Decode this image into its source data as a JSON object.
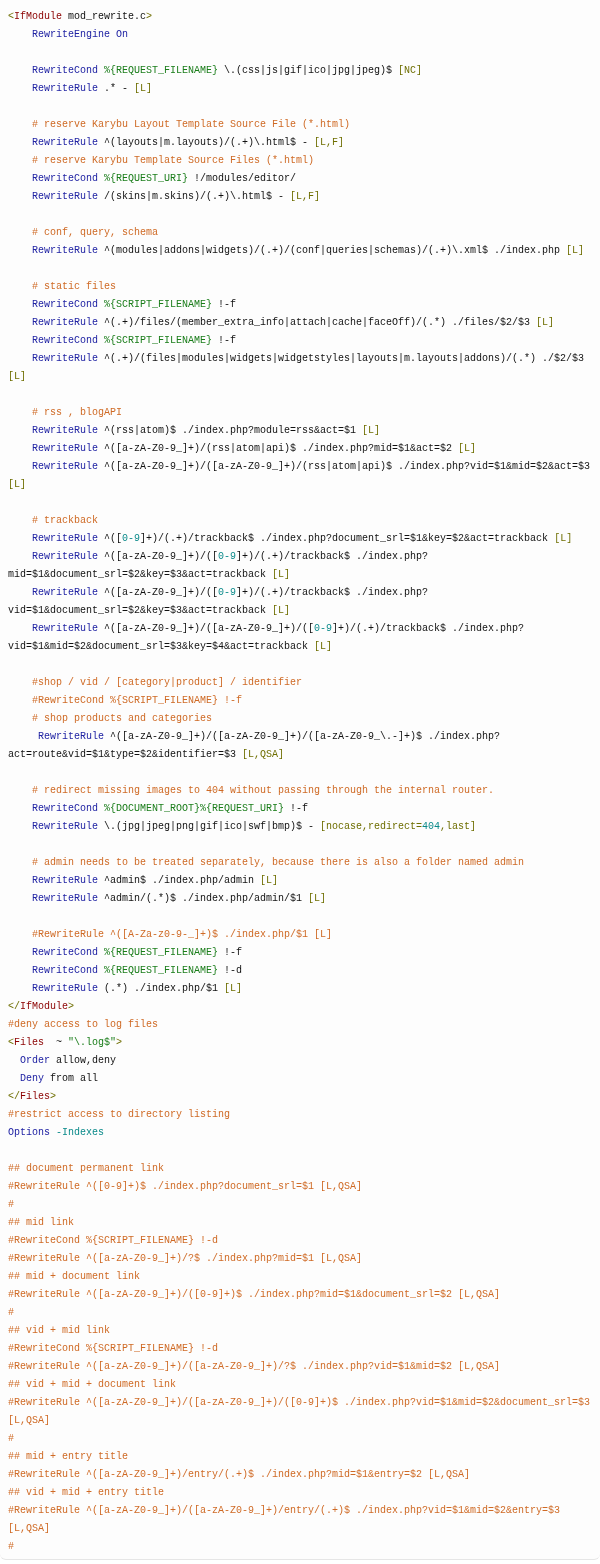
{
  "code_listing": {
    "lines": [
      {
        "kind": "plain",
        "tokens": [
          {
            "kind": "op",
            "text": "<"
          },
          {
            "kind": "tag",
            "text": "IfModule"
          },
          {
            "kind": "txt",
            "text": " mod_rewrite.c"
          },
          {
            "kind": "op",
            "text": ">"
          }
        ]
      },
      {
        "kind": "block",
        "tokens": [
          {
            "kind": "dir",
            "text": "RewriteEngine"
          },
          {
            "kind": "dir",
            "text": " On"
          }
        ]
      },
      {
        "kind": "blank"
      },
      {
        "kind": "block",
        "tokens": [
          {
            "kind": "dir",
            "text": "RewriteCond"
          },
          {
            "kind": "var",
            "text": " %{REQUEST_FILENAME}"
          },
          {
            "kind": "txt",
            "text": " \\.(css|js|gif|ico|jpg|jpeg)$ "
          },
          {
            "kind": "flag",
            "text": "[NC]"
          }
        ]
      },
      {
        "kind": "block",
        "tokens": [
          {
            "kind": "dir",
            "text": "RewriteRule"
          },
          {
            "kind": "txt",
            "text": " .* - "
          },
          {
            "kind": "flag",
            "text": "[L]"
          }
        ]
      },
      {
        "kind": "blank"
      },
      {
        "kind": "block",
        "tokens": [
          {
            "kind": "com",
            "text": "# reserve Karybu Layout Template Source File (*.html)"
          }
        ]
      },
      {
        "kind": "block",
        "tokens": [
          {
            "kind": "dir",
            "text": "RewriteRule"
          },
          {
            "kind": "txt",
            "text": " ^(layouts|m.layouts)/(.+)\\.html$ - "
          },
          {
            "kind": "flag",
            "text": "[L,F]"
          }
        ]
      },
      {
        "kind": "block",
        "tokens": [
          {
            "kind": "com",
            "text": "# reserve Karybu Template Source Files (*.html)"
          }
        ]
      },
      {
        "kind": "block",
        "tokens": [
          {
            "kind": "dir",
            "text": "RewriteCond"
          },
          {
            "kind": "var",
            "text": " %{REQUEST_URI}"
          },
          {
            "kind": "txt",
            "text": " !/modules/editor/"
          }
        ]
      },
      {
        "kind": "block",
        "tokens": [
          {
            "kind": "dir",
            "text": "RewriteRule"
          },
          {
            "kind": "txt",
            "text": " /(skins|m.skins)/(.+)\\.html$ - "
          },
          {
            "kind": "flag",
            "text": "[L,F]"
          }
        ]
      },
      {
        "kind": "blank"
      },
      {
        "kind": "block",
        "tokens": [
          {
            "kind": "com",
            "text": "# conf, query, schema"
          }
        ]
      },
      {
        "kind": "block",
        "tokens": [
          {
            "kind": "dir",
            "text": "RewriteRule"
          },
          {
            "kind": "txt",
            "text": " ^(modules|addons|widgets)/(.+)/(conf|queries|schemas)/(.+)\\.xml$ ./index.php "
          },
          {
            "kind": "flag",
            "text": "[L]"
          }
        ]
      },
      {
        "kind": "blank"
      },
      {
        "kind": "block",
        "tokens": [
          {
            "kind": "com",
            "text": "# static files"
          }
        ]
      },
      {
        "kind": "block",
        "tokens": [
          {
            "kind": "dir",
            "text": "RewriteCond"
          },
          {
            "kind": "var",
            "text": " %{SCRIPT_FILENAME}"
          },
          {
            "kind": "txt",
            "text": " !-f"
          }
        ]
      },
      {
        "kind": "block",
        "tokens": [
          {
            "kind": "dir",
            "text": "RewriteRule"
          },
          {
            "kind": "txt",
            "text": " ^(.+)/files/(member_extra_info|attach|cache|faceOff)/(.*) ./files/$2/$3 "
          },
          {
            "kind": "flag",
            "text": "[L]"
          }
        ]
      },
      {
        "kind": "block",
        "tokens": [
          {
            "kind": "dir",
            "text": "RewriteCond"
          },
          {
            "kind": "var",
            "text": " %{SCRIPT_FILENAME}"
          },
          {
            "kind": "txt",
            "text": " !-f"
          }
        ]
      },
      {
        "kind": "block",
        "tokens": [
          {
            "kind": "dir",
            "text": "RewriteRule"
          },
          {
            "kind": "txt",
            "text": " ^(.+)/(files|modules|widgets|widgetstyles|layouts|m.layouts|addons)/(.*) ./$2/$3"
          }
        ]
      },
      {
        "kind": "plain",
        "tokens": [
          {
            "kind": "flag",
            "text": "[L]"
          }
        ]
      },
      {
        "kind": "blank"
      },
      {
        "kind": "block",
        "tokens": [
          {
            "kind": "com",
            "text": "# rss , blogAPI"
          }
        ]
      },
      {
        "kind": "block",
        "tokens": [
          {
            "kind": "dir",
            "text": "RewriteRule"
          },
          {
            "kind": "txt",
            "text": " ^(rss|atom)$ ./index.php?module=rss&act=$1 "
          },
          {
            "kind": "flag",
            "text": "[L]"
          }
        ]
      },
      {
        "kind": "block",
        "tokens": [
          {
            "kind": "dir",
            "text": "RewriteRule"
          },
          {
            "kind": "txt",
            "text": " ^([a-zA-Z0-9_]+)/(rss|atom|api)$ ./index.php?mid=$1&act=$2 "
          },
          {
            "kind": "flag",
            "text": "[L]"
          }
        ]
      },
      {
        "kind": "block",
        "tokens": [
          {
            "kind": "dir",
            "text": "RewriteRule"
          },
          {
            "kind": "txt",
            "text": " ^([a-zA-Z0-9_]+)/([a-zA-Z0-9_]+)/(rss|atom|api)$ ./index.php?vid=$1&mid=$2&act=$3"
          }
        ]
      },
      {
        "kind": "plain",
        "tokens": [
          {
            "kind": "flag",
            "text": "[L]"
          }
        ]
      },
      {
        "kind": "blank"
      },
      {
        "kind": "block",
        "tokens": [
          {
            "kind": "com",
            "text": "# trackback"
          }
        ]
      },
      {
        "kind": "block",
        "tokens": [
          {
            "kind": "dir",
            "text": "RewriteRule"
          },
          {
            "kind": "txt",
            "text": " ^(["
          },
          {
            "kind": "num",
            "text": "0-9"
          },
          {
            "kind": "txt",
            "text": "]+)/(.+)/trackback$ ./index.php?document_srl=$1&key=$2&act=trackback "
          },
          {
            "kind": "flag",
            "text": "[L]"
          }
        ]
      },
      {
        "kind": "block",
        "tokens": [
          {
            "kind": "dir",
            "text": "RewriteRule"
          },
          {
            "kind": "txt",
            "text": " ^([a-zA-Z0-9_]+)/(["
          },
          {
            "kind": "num",
            "text": "0-9"
          },
          {
            "kind": "txt",
            "text": "]+)/(.+)/trackback$ ./index.php?"
          }
        ]
      },
      {
        "kind": "plain",
        "tokens": [
          {
            "kind": "txt",
            "text": "mid=$1&document_srl=$2&key=$3&act=trackback "
          },
          {
            "kind": "flag",
            "text": "[L]"
          }
        ]
      },
      {
        "kind": "block",
        "tokens": [
          {
            "kind": "dir",
            "text": "RewriteRule"
          },
          {
            "kind": "txt",
            "text": " ^([a-zA-Z0-9_]+)/(["
          },
          {
            "kind": "num",
            "text": "0-9"
          },
          {
            "kind": "txt",
            "text": "]+)/(.+)/trackback$ ./index.php?"
          }
        ]
      },
      {
        "kind": "plain",
        "tokens": [
          {
            "kind": "txt",
            "text": "vid=$1&document_srl=$2&key=$3&act=trackback "
          },
          {
            "kind": "flag",
            "text": "[L]"
          }
        ]
      },
      {
        "kind": "block",
        "tokens": [
          {
            "kind": "dir",
            "text": "RewriteRule"
          },
          {
            "kind": "txt",
            "text": " ^([a-zA-Z0-9_]+)/([a-zA-Z0-9_]+)/(["
          },
          {
            "kind": "num",
            "text": "0-9"
          },
          {
            "kind": "txt",
            "text": "]+)/(.+)/trackback$ ./index.php?"
          }
        ]
      },
      {
        "kind": "plain",
        "tokens": [
          {
            "kind": "txt",
            "text": "vid=$1&mid=$2&document_srl=$3&key=$4&act=trackback "
          },
          {
            "kind": "flag",
            "text": "[L]"
          }
        ]
      },
      {
        "kind": "blank"
      },
      {
        "kind": "block",
        "tokens": [
          {
            "kind": "com",
            "text": "#shop / vid / [category|product] / identifier"
          }
        ]
      },
      {
        "kind": "block",
        "tokens": [
          {
            "kind": "com",
            "text": "#RewriteCond %{SCRIPT_FILENAME} !-f"
          }
        ]
      },
      {
        "kind": "block",
        "tokens": [
          {
            "kind": "com",
            "text": "# shop products and categories"
          }
        ]
      },
      {
        "kind": "offset",
        "tokens": [
          {
            "kind": "dir",
            "text": "RewriteRule"
          },
          {
            "kind": "txt",
            "text": " ^([a-zA-Z0-9_]+)/([a-zA-Z0-9_]+)/([a-zA-Z0-9_\\.-]+)$ ./index.php?"
          }
        ]
      },
      {
        "kind": "plain",
        "tokens": [
          {
            "kind": "txt",
            "text": "act=route&vid=$1&type=$2&identifier=$3 "
          },
          {
            "kind": "flag",
            "text": "[L,QSA]"
          }
        ]
      },
      {
        "kind": "blank"
      },
      {
        "kind": "block",
        "tokens": [
          {
            "kind": "com",
            "text": "# redirect missing images to 404 without passing through the internal router."
          }
        ]
      },
      {
        "kind": "block",
        "tokens": [
          {
            "kind": "dir",
            "text": "RewriteCond"
          },
          {
            "kind": "var",
            "text": " %{DOCUMENT_ROOT}%{REQUEST_URI}"
          },
          {
            "kind": "txt",
            "text": " !-f"
          }
        ]
      },
      {
        "kind": "block",
        "tokens": [
          {
            "kind": "dir",
            "text": "RewriteRule"
          },
          {
            "kind": "txt",
            "text": " \\.(jpg|jpeg|png|gif|ico|swf|bmp)$ - "
          },
          {
            "kind": "flag",
            "text": "[nocase,redirect="
          },
          {
            "kind": "num",
            "text": "404"
          },
          {
            "kind": "flag",
            "text": ",last]"
          }
        ]
      },
      {
        "kind": "blank"
      },
      {
        "kind": "block",
        "tokens": [
          {
            "kind": "com",
            "text": "# admin needs to be treated separately, because there is also a folder named admin"
          }
        ]
      },
      {
        "kind": "block",
        "tokens": [
          {
            "kind": "dir",
            "text": "RewriteRule"
          },
          {
            "kind": "txt",
            "text": " ^admin$ ./index.php/admin "
          },
          {
            "kind": "flag",
            "text": "[L]"
          }
        ]
      },
      {
        "kind": "block",
        "tokens": [
          {
            "kind": "dir",
            "text": "RewriteRule"
          },
          {
            "kind": "txt",
            "text": " ^admin/(.*)$ ./index.php/admin/$1 "
          },
          {
            "kind": "flag",
            "text": "[L]"
          }
        ]
      },
      {
        "kind": "blank"
      },
      {
        "kind": "block",
        "tokens": [
          {
            "kind": "com",
            "text": "#RewriteRule ^([A-Za-z0-9-_]+)$ ./index.php/$1 [L]"
          }
        ]
      },
      {
        "kind": "block",
        "tokens": [
          {
            "kind": "dir",
            "text": "RewriteCond"
          },
          {
            "kind": "var",
            "text": " %{REQUEST_FILENAME}"
          },
          {
            "kind": "txt",
            "text": " !-f"
          }
        ]
      },
      {
        "kind": "block",
        "tokens": [
          {
            "kind": "dir",
            "text": "RewriteCond"
          },
          {
            "kind": "var",
            "text": " %{REQUEST_FILENAME}"
          },
          {
            "kind": "txt",
            "text": " !-d"
          }
        ]
      },
      {
        "kind": "block",
        "tokens": [
          {
            "kind": "dir",
            "text": "RewriteRule"
          },
          {
            "kind": "txt",
            "text": " (.*) ./index.php/$1 "
          },
          {
            "kind": "flag",
            "text": "[L]"
          }
        ]
      },
      {
        "kind": "plain",
        "tokens": [
          {
            "kind": "op",
            "text": "</"
          },
          {
            "kind": "tag",
            "text": "IfModule"
          },
          {
            "kind": "op",
            "text": ">"
          }
        ]
      },
      {
        "kind": "plain",
        "tokens": [
          {
            "kind": "com",
            "text": "#deny access to log files"
          }
        ]
      },
      {
        "kind": "plain",
        "tokens": [
          {
            "kind": "op",
            "text": "<"
          },
          {
            "kind": "tag",
            "text": "Files"
          },
          {
            "kind": "txt",
            "text": "  ~ "
          },
          {
            "kind": "var",
            "text": "\"\\.log$\""
          },
          {
            "kind": "op",
            "text": ">"
          }
        ]
      },
      {
        "kind": "shallow",
        "tokens": [
          {
            "kind": "dir",
            "text": "Order"
          },
          {
            "kind": "txt",
            "text": " allow,deny"
          }
        ]
      },
      {
        "kind": "shallow",
        "tokens": [
          {
            "kind": "dir",
            "text": "Deny"
          },
          {
            "kind": "txt",
            "text": " from all"
          }
        ]
      },
      {
        "kind": "plain",
        "tokens": [
          {
            "kind": "op",
            "text": "</"
          },
          {
            "kind": "tag",
            "text": "Files"
          },
          {
            "kind": "op",
            "text": ">"
          }
        ]
      },
      {
        "kind": "plain",
        "tokens": [
          {
            "kind": "com",
            "text": "#restrict access to directory listing"
          }
        ]
      },
      {
        "kind": "plain",
        "tokens": [
          {
            "kind": "dir",
            "text": "Options"
          },
          {
            "kind": "num",
            "text": " -Indexes"
          }
        ]
      },
      {
        "kind": "blank"
      },
      {
        "kind": "plain",
        "tokens": [
          {
            "kind": "com",
            "text": "## document permanent link"
          }
        ]
      },
      {
        "kind": "plain",
        "tokens": [
          {
            "kind": "com",
            "text": "#RewriteRule ^([0-9]+)$ ./index.php?document_srl=$1 [L,QSA]"
          }
        ]
      },
      {
        "kind": "plain",
        "tokens": [
          {
            "kind": "com",
            "text": "#"
          }
        ]
      },
      {
        "kind": "plain",
        "tokens": [
          {
            "kind": "com",
            "text": "## mid link"
          }
        ]
      },
      {
        "kind": "plain",
        "tokens": [
          {
            "kind": "com",
            "text": "#RewriteCond %{SCRIPT_FILENAME} !-d"
          }
        ]
      },
      {
        "kind": "plain",
        "tokens": [
          {
            "kind": "com",
            "text": "#RewriteRule ^([a-zA-Z0-9_]+)/?$ ./index.php?mid=$1 [L,QSA]"
          }
        ]
      },
      {
        "kind": "plain",
        "tokens": [
          {
            "kind": "com",
            "text": "## mid + document link"
          }
        ]
      },
      {
        "kind": "plain",
        "tokens": [
          {
            "kind": "com",
            "text": "#RewriteRule ^([a-zA-Z0-9_]+)/([0-9]+)$ ./index.php?mid=$1&document_srl=$2 [L,QSA]"
          }
        ]
      },
      {
        "kind": "plain",
        "tokens": [
          {
            "kind": "com",
            "text": "#"
          }
        ]
      },
      {
        "kind": "plain",
        "tokens": [
          {
            "kind": "com",
            "text": "## vid + mid link"
          }
        ]
      },
      {
        "kind": "plain",
        "tokens": [
          {
            "kind": "com",
            "text": "#RewriteCond %{SCRIPT_FILENAME} !-d"
          }
        ]
      },
      {
        "kind": "plain",
        "tokens": [
          {
            "kind": "com",
            "text": "#RewriteRule ^([a-zA-Z0-9_]+)/([a-zA-Z0-9_]+)/?$ ./index.php?vid=$1&mid=$2 [L,QSA]"
          }
        ]
      },
      {
        "kind": "plain",
        "tokens": [
          {
            "kind": "com",
            "text": "## vid + mid + document link"
          }
        ]
      },
      {
        "kind": "plain",
        "tokens": [
          {
            "kind": "com",
            "text": "#RewriteRule ^([a-zA-Z0-9_]+)/([a-zA-Z0-9_]+)/([0-9]+)$ ./index.php?vid=$1&mid=$2&document_srl=$3"
          }
        ]
      },
      {
        "kind": "plain",
        "tokens": [
          {
            "kind": "com",
            "text": "[L,QSA]"
          }
        ]
      },
      {
        "kind": "plain",
        "tokens": [
          {
            "kind": "com",
            "text": "#"
          }
        ]
      },
      {
        "kind": "plain",
        "tokens": [
          {
            "kind": "com",
            "text": "## mid + entry title"
          }
        ]
      },
      {
        "kind": "plain",
        "tokens": [
          {
            "kind": "com",
            "text": "#RewriteRule ^([a-zA-Z0-9_]+)/entry/(.+)$ ./index.php?mid=$1&entry=$2 [L,QSA]"
          }
        ]
      },
      {
        "kind": "plain",
        "tokens": [
          {
            "kind": "com",
            "text": "## vid + mid + entry title"
          }
        ]
      },
      {
        "kind": "plain",
        "tokens": [
          {
            "kind": "com",
            "text": "#RewriteRule ^([a-zA-Z0-9_]+)/([a-zA-Z0-9_]+)/entry/(.+)$ ./index.php?vid=$1&mid=$2&entry=$3"
          }
        ]
      },
      {
        "kind": "plain",
        "tokens": [
          {
            "kind": "com",
            "text": "[L,QSA]"
          }
        ]
      },
      {
        "kind": "plain",
        "tokens": [
          {
            "kind": "com",
            "text": "#"
          }
        ]
      }
    ]
  }
}
